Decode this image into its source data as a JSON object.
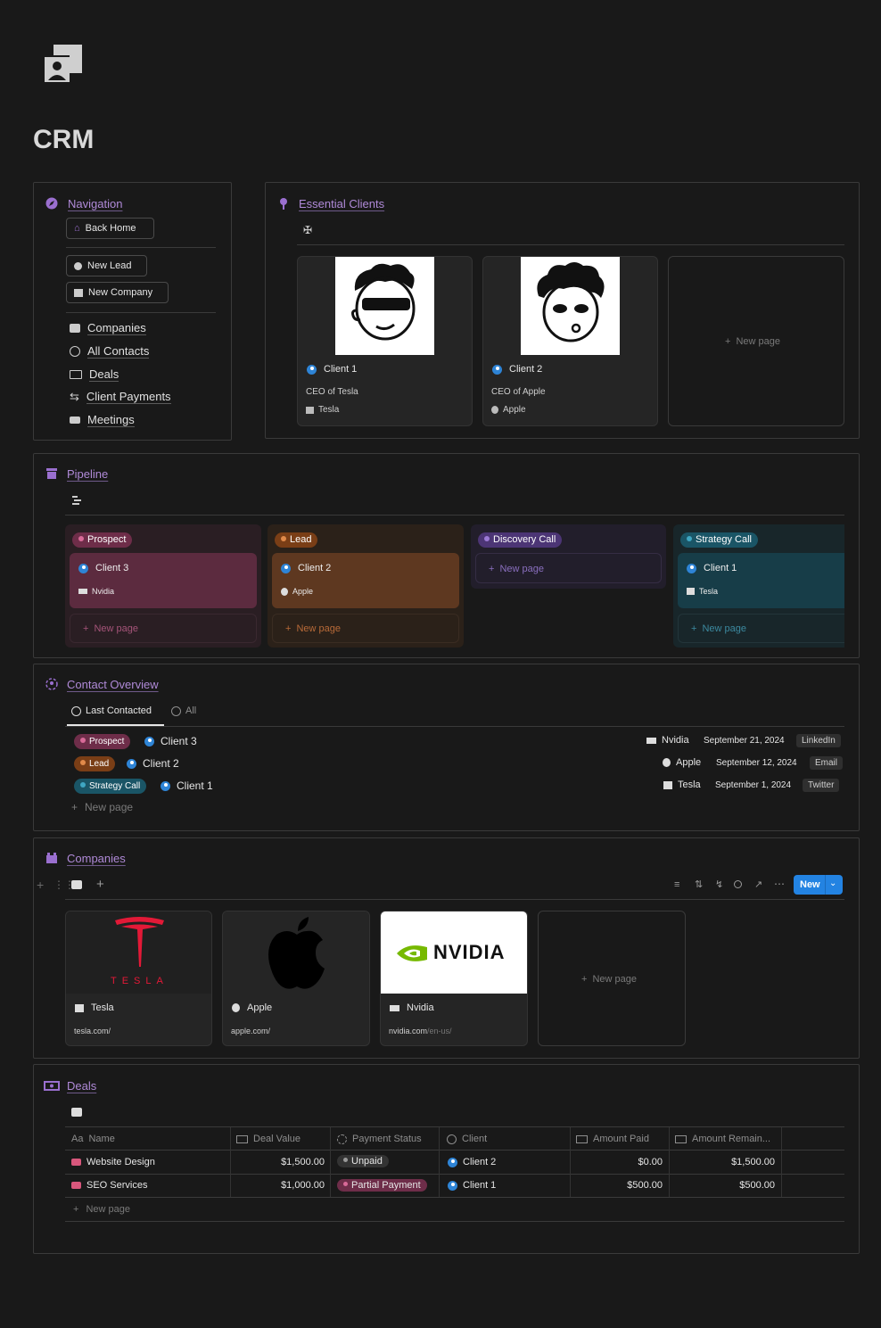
{
  "page": {
    "title": "CRM"
  },
  "navigation": {
    "title": "Navigation",
    "buttons": {
      "back_home": "Back Home",
      "new_lead": "New Lead",
      "new_company": "New Company"
    },
    "links": [
      "Companies",
      "All Contacts",
      "Deals",
      "Client Payments",
      "Meetings"
    ]
  },
  "essential_clients": {
    "title": "Essential Clients",
    "cards": [
      {
        "name": "Client 1",
        "role": "CEO of Tesla",
        "company": "Tesla"
      },
      {
        "name": "Client 2",
        "role": "CEO of Apple",
        "company": "Apple"
      }
    ],
    "new_page": "New page"
  },
  "pipeline": {
    "title": "Pipeline",
    "columns": [
      {
        "label": "Prospect",
        "card_name": "Client 3",
        "card_company": "Nvidia",
        "new_page": "New page"
      },
      {
        "label": "Lead",
        "card_name": "Client 2",
        "card_company": "Apple",
        "new_page": "New page"
      },
      {
        "label": "Discovery Call",
        "new_page": "New page"
      },
      {
        "label": "Strategy Call",
        "card_name": "Client 1",
        "card_company": "Tesla",
        "new_page": "New page"
      }
    ]
  },
  "contact_overview": {
    "title": "Contact Overview",
    "tabs": [
      "Last Contacted",
      "All"
    ],
    "rows": [
      {
        "stage": "Prospect",
        "name": "Client 3",
        "company": "Nvidia",
        "date": "September 21, 2024",
        "channel": "LinkedIn"
      },
      {
        "stage": "Lead",
        "name": "Client 2",
        "company": "Apple",
        "date": "September 12, 2024",
        "channel": "Email"
      },
      {
        "stage": "Strategy Call",
        "name": "Client 1",
        "company": "Tesla",
        "date": "September 1, 2024",
        "channel": "Twitter"
      }
    ],
    "new_page": "New page"
  },
  "companies": {
    "title": "Companies",
    "new_button": "New",
    "cards": [
      {
        "name": "Tesla",
        "url": "tesla.com/",
        "url_dim": ""
      },
      {
        "name": "Apple",
        "url": "apple.com/",
        "url_dim": ""
      },
      {
        "name": "Nvidia",
        "url": "nvidia.com",
        "url_dim": "/en-us/"
      }
    ],
    "logo_texts": {
      "tesla": "TESLA",
      "nvidia": "NVIDIA"
    },
    "new_page": "New page"
  },
  "deals": {
    "title": "Deals",
    "headers": [
      "Name",
      "Deal Value",
      "Payment Status",
      "Client",
      "Amount Paid",
      "Amount Remain..."
    ],
    "header_prefix_name": "Aa",
    "rows": [
      {
        "name": "Website Design",
        "value": "$1,500.00",
        "status": "Unpaid",
        "client": "Client 2",
        "paid": "$0.00",
        "remaining": "$1,500.00"
      },
      {
        "name": "SEO Services",
        "value": "$1,000.00",
        "status": "Partial Payment",
        "client": "Client 1",
        "paid": "$500.00",
        "remaining": "$500.00"
      }
    ],
    "new_page": "New page"
  },
  "colors": {
    "accent": "#b08ad8",
    "prospect": "#8a3a5c",
    "lead": "#8c4a1e",
    "discovery": "#5b3f8a",
    "strategy": "#1d5a6e",
    "new_button": "#2383e2"
  }
}
